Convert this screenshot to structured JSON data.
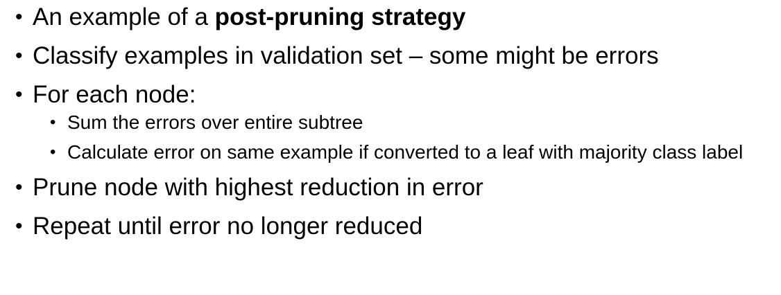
{
  "bullets": [
    {
      "prefix": "An example of a ",
      "bold": "post-pruning strategy"
    },
    {
      "text": "Classify examples in validation set – some might be errors"
    },
    {
      "text": "For each node:",
      "sub": [
        "Sum the errors over entire subtree",
        "Calculate error on same example if converted to a leaf with majority class label"
      ]
    },
    {
      "text": "Prune node with highest reduction in error"
    },
    {
      "text": "Repeat until error no longer reduced"
    }
  ],
  "bullet_glyph": "•"
}
